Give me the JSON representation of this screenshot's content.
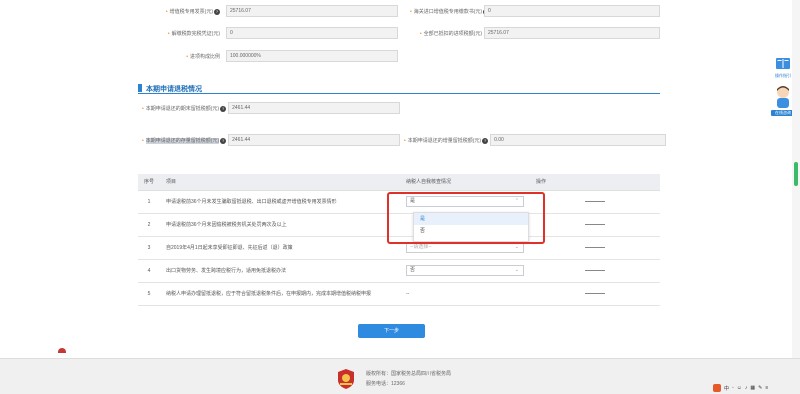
{
  "fields": {
    "row1_left_label": "增值税专用发票(元)",
    "row1_left_value": "25716.07",
    "row1_right_label": "海关进口增值税专用缴款书(元)",
    "row1_right_value": "0",
    "row2_left_label": "解缴税款完税凭证(元)",
    "row2_left_value": "0",
    "row2_right_label": "全部已抵扣的进项税额(元)",
    "row2_right_value": "25716.07",
    "row3_left_label": "进项构成比例",
    "row3_left_value": "100.000000%"
  },
  "section": {
    "title": "本期申请退税情况",
    "a_label": "本期申请退还的期末留抵税额(元)",
    "a_value": "2461.44",
    "b_label": "本期申请退还的存量留抵税额(元)",
    "b_value": "2461.44",
    "c_label": "本期申请退还的增量留抵税额(元)",
    "c_value": "0.00"
  },
  "table": {
    "headers": [
      "序号",
      "项目",
      "纳税人自我核查情况",
      "操作"
    ],
    "rows": [
      {
        "no": "1",
        "item": "申请退税前36个月未发生骗取留抵退税、出口退税或虚开增值税专用发票情形",
        "status": "是"
      },
      {
        "no": "2",
        "item": "申请退税前36个月未因偷税被税务机关处罚两次及以上",
        "status": ""
      },
      {
        "no": "3",
        "item": "自2019年4月1日起未享受即征即退、先征后返（退）政策",
        "status": "--请选择--"
      },
      {
        "no": "4",
        "item": "出口货物劳务、发生跨境应税行为，适用免抵退税办法",
        "status": "否"
      },
      {
        "no": "5",
        "item": "纳税人申请办理留抵退税，应于符合留抵退税条件后，在申报期内，完成本期增值税纳税申报",
        "status": "--"
      }
    ]
  },
  "dropdown": {
    "options": [
      "是",
      "否"
    ]
  },
  "buttons": {
    "next": "下一步"
  },
  "side": {
    "help_label": "操作指引",
    "service_label": "在线咨询"
  },
  "footer": {
    "copyright": "版权所有：国家税务总局四川省税务局",
    "hotline": "服务电话：12366"
  },
  "colors": {
    "accent": "#2c83d1",
    "highlight": "#e0302a",
    "button": "#2f8be0"
  }
}
